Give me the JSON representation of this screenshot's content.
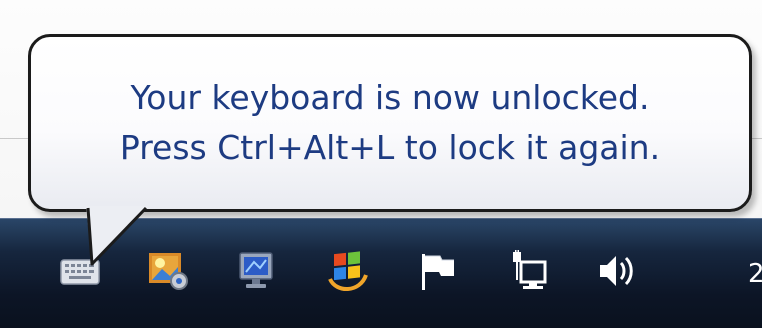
{
  "notification": {
    "line1": "Your keyboard is now unlocked.",
    "line2": "Press Ctrl+Alt+L to lock it again."
  },
  "taskbar": {
    "clock_text": "2",
    "tray_icons": [
      {
        "icon": "keyboard-icon"
      },
      {
        "icon": "photo-settings-icon"
      },
      {
        "icon": "monitor-icon"
      },
      {
        "icon": "windows-update-icon"
      },
      {
        "icon": "flag-icon"
      },
      {
        "icon": "network-icon"
      },
      {
        "icon": "speaker-icon"
      }
    ]
  },
  "colors": {
    "balloon_text": "#1d3b82",
    "taskbar_bg": "#0c1526",
    "balloon_border": "#1b1b1b"
  }
}
